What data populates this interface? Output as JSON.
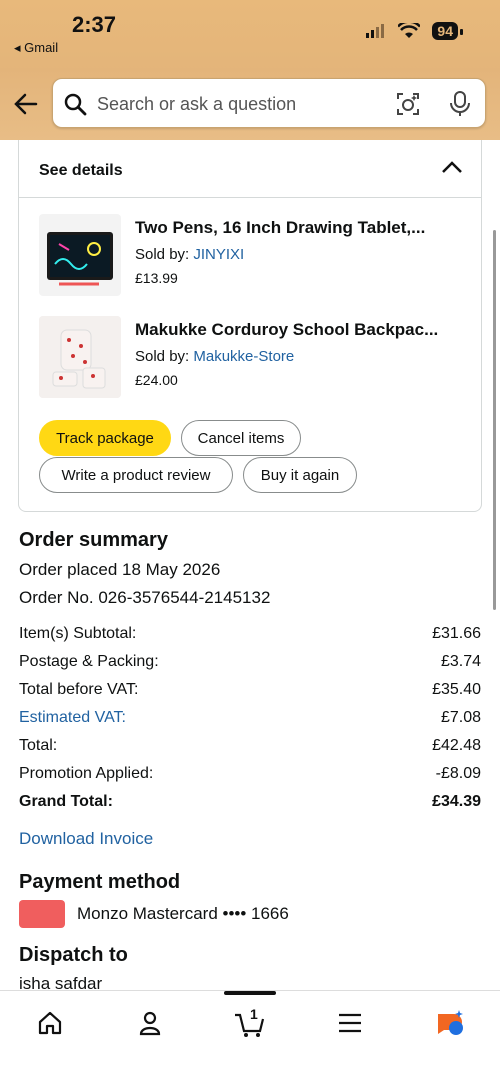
{
  "status": {
    "time": "2:37",
    "back_app": "◂ Gmail",
    "battery": "94"
  },
  "search": {
    "placeholder": "Search or ask a question"
  },
  "details": {
    "label": "See details",
    "items": [
      {
        "title": "Two Pens, 16 Inch Drawing Tablet,...",
        "sold_by_label": "Sold by:",
        "seller": "JINYIXI",
        "price": "£13.99"
      },
      {
        "title": "Makukke Corduroy School Backpac...",
        "sold_by_label": "Sold by:",
        "seller": "Makukke-Store",
        "price": "£24.00"
      }
    ],
    "buttons": {
      "track": "Track package",
      "cancel": "Cancel items",
      "review": "Write a product review",
      "buy_again": "Buy it again"
    }
  },
  "order": {
    "title": "Order summary",
    "placed": "Order placed 18 May 2026",
    "number": "Order No. 026-3576544-2145132",
    "rows": [
      {
        "label": "Item(s) Subtotal:",
        "value": "£31.66"
      },
      {
        "label": "Postage & Packing:",
        "value": "£3.74"
      },
      {
        "label": "Total before VAT:",
        "value": "£35.40"
      },
      {
        "label": "Estimated VAT:",
        "value": "£7.08"
      },
      {
        "label": "Total:",
        "value": "£42.48"
      },
      {
        "label": "Promotion Applied:",
        "value": "-£8.09"
      },
      {
        "label": "Grand Total:",
        "value": "£34.39"
      }
    ],
    "download": "Download Invoice"
  },
  "payment": {
    "title": "Payment method",
    "card": "Monzo Mastercard •••• 1666"
  },
  "dispatch": {
    "title": "Dispatch to",
    "name": "isha safdar"
  },
  "nav": {
    "cart_count": "1"
  },
  "colors": {
    "header": "#e3b47a",
    "link": "#2162a1",
    "primary_button": "#ffd814"
  }
}
